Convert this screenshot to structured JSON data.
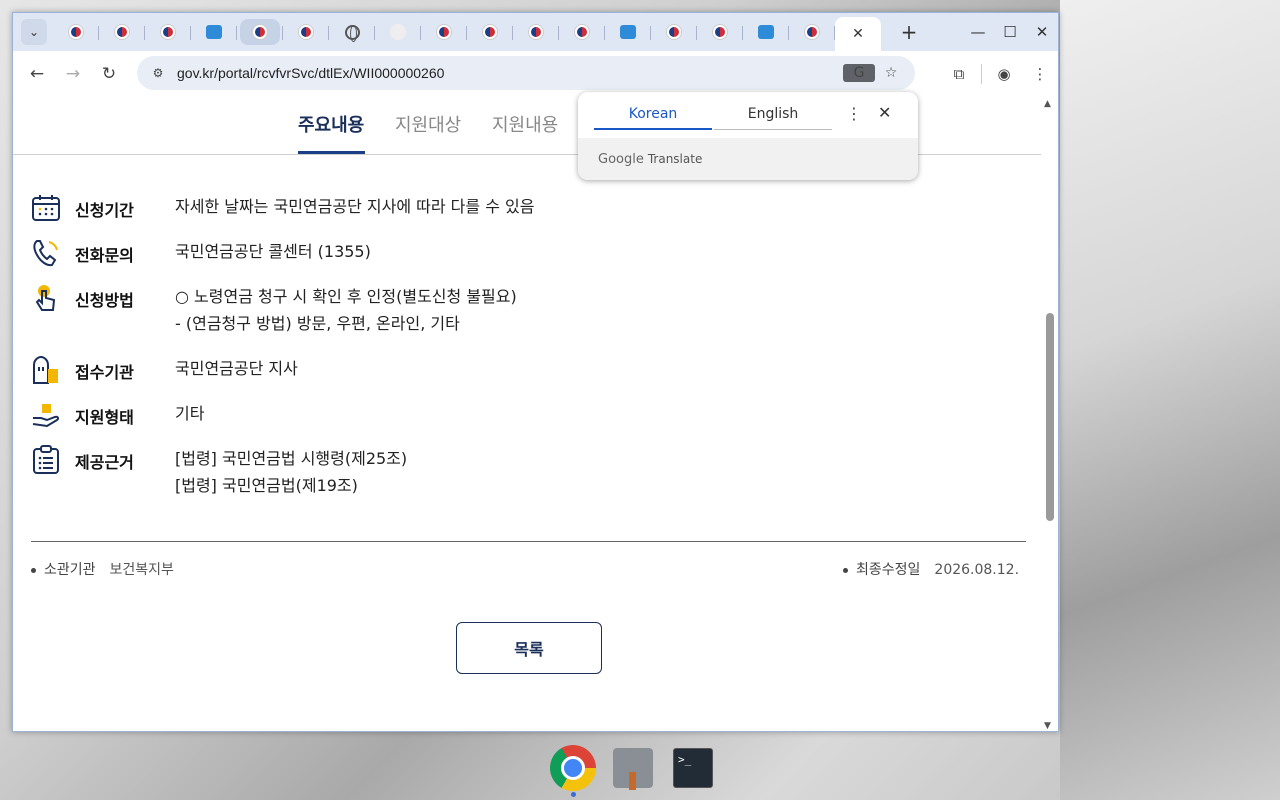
{
  "browser": {
    "url": "gov.kr/portal/rcvfvrSvc/dtlEx/WII000000260",
    "tabs_favicons": [
      "gov",
      "gov",
      "gov",
      "box",
      "gov",
      "gov",
      "globe",
      "text",
      "gov",
      "gov",
      "gov",
      "gov",
      "box",
      "gov",
      "gov",
      "box",
      "gov",
      "gov"
    ],
    "active_tab_close": "✕",
    "new_tab": "+",
    "tab_search_icon": "chevron-down-icon"
  },
  "page": {
    "subtabs": [
      "주요내용",
      "지원대상",
      "지원내용"
    ],
    "rows": [
      {
        "label": "신청기간",
        "values": [
          "자세한 날짜는 국민연금공단 지사에 따라 다를 수 있음"
        ],
        "icon": "calendar-icon"
      },
      {
        "label": "전화문의",
        "values": [
          "국민연금공단 콜센터 (1355)"
        ],
        "icon": "phone-icon"
      },
      {
        "label": "신청방법",
        "values": [
          "○ 노령연금 청구 시 확인 후 인정(별도신청 불필요)",
          "- (연금청구 방법) 방문, 우편, 온라인, 기타"
        ],
        "icon": "hand-pointer-icon"
      },
      {
        "label": "접수기관",
        "values": [
          "국민연금공단 지사"
        ],
        "icon": "building-icon"
      },
      {
        "label": "지원형태",
        "values": [
          "기타"
        ],
        "icon": "hand-gift-icon"
      },
      {
        "label": "제공근거",
        "values": [
          "[법령] 국민연금법 시행령(제25조)",
          "[법령] 국민연금법(제19조)"
        ],
        "icon": "clipboard-list-icon"
      }
    ],
    "meta_left": {
      "label": "소관기관",
      "value": "보건복지부"
    },
    "meta_right": {
      "label": "최종수정일",
      "value": "2026.08.12."
    },
    "list_button": "목록"
  },
  "translate_popup": {
    "lang_source": "Korean",
    "lang_target": "English",
    "footer_brand": "Google",
    "footer_text": "Translate"
  }
}
